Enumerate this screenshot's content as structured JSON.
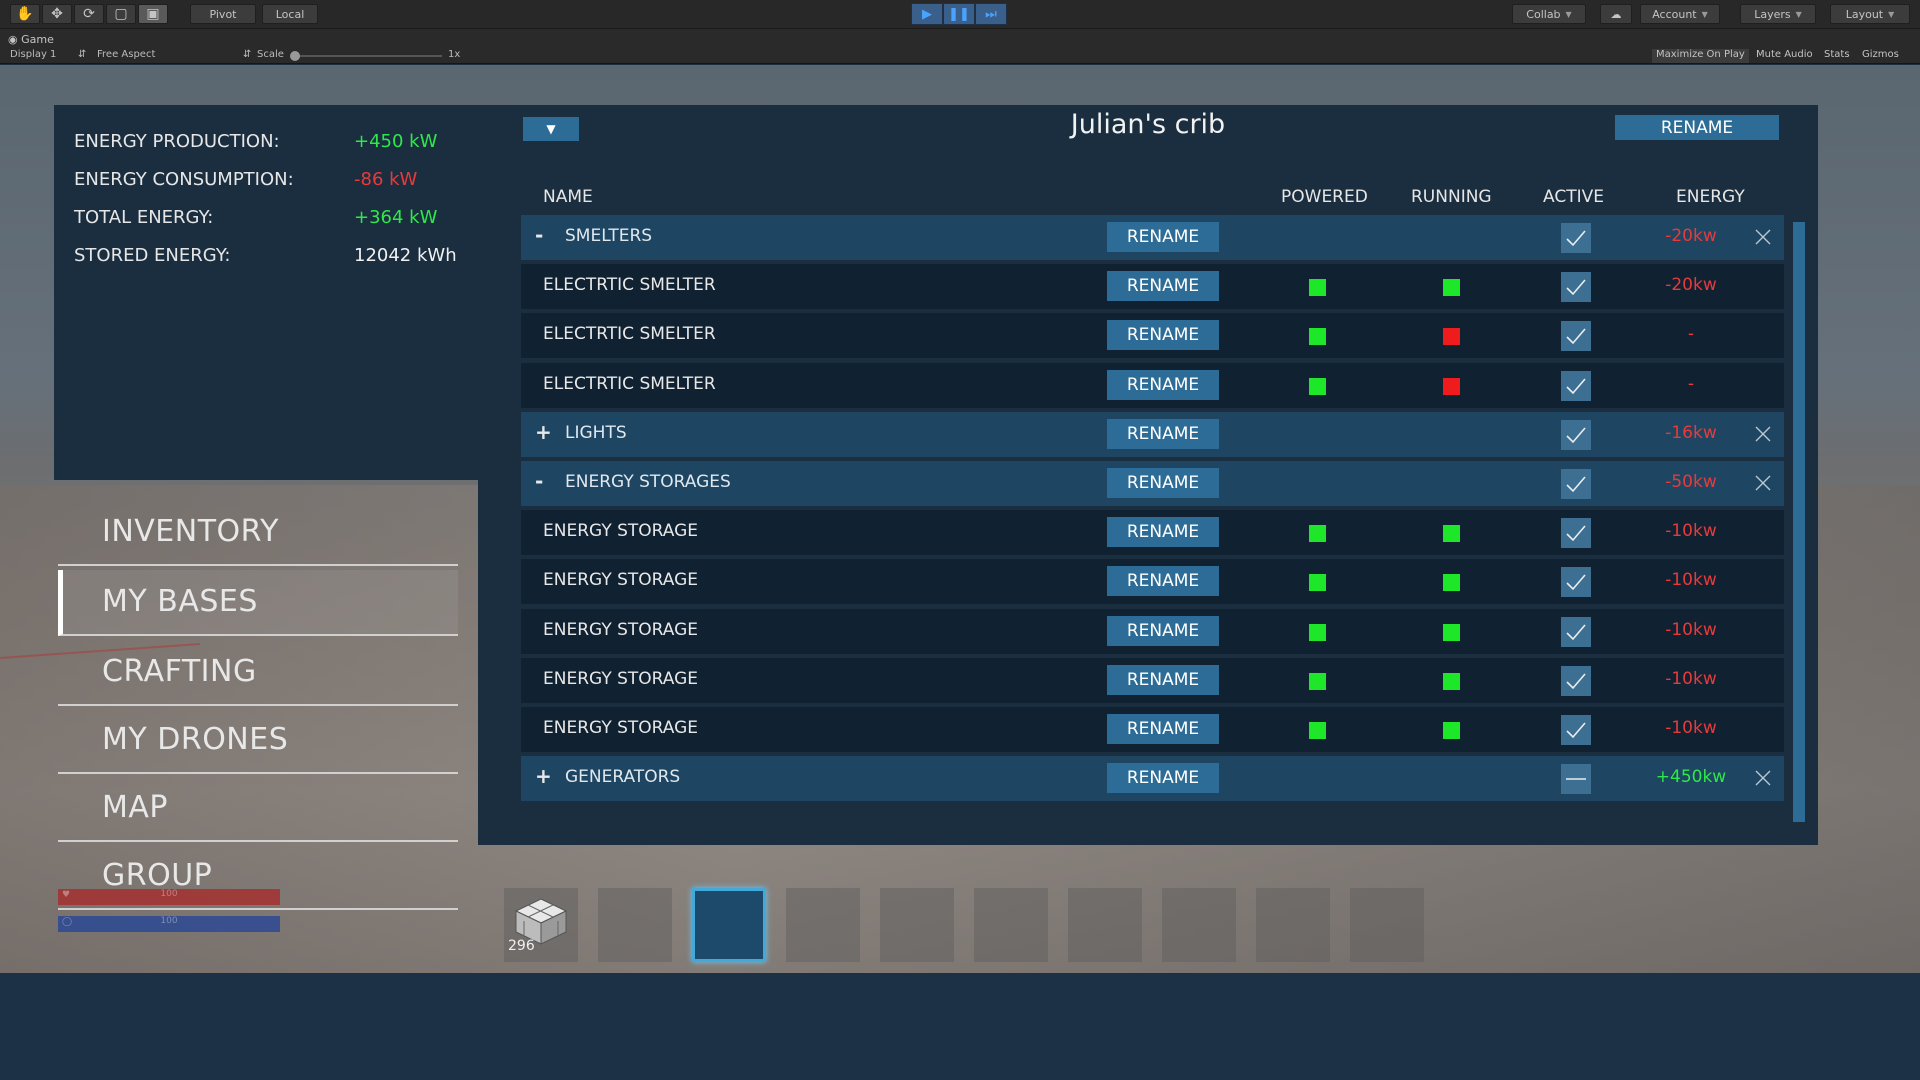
{
  "toolbar": {
    "tools": [
      "hand-tool",
      "move-tool",
      "rotate-tool",
      "scale-tool",
      "rect-tool"
    ],
    "pivot": "Pivot",
    "local": "Local",
    "collab": "Collab",
    "account": "Account",
    "layers": "Layers",
    "layout": "Layout"
  },
  "gamebar": {
    "tab": "Game",
    "display": "Display 1",
    "aspect": "Free Aspect",
    "scale_label": "Scale",
    "scale_value": "1x",
    "maximize": "Maximize On Play",
    "mute": "Mute Audio",
    "stats": "Stats",
    "gizmos": "Gizmos"
  },
  "colors": {
    "positive": "#2ee84a",
    "negative": "#e83a3a",
    "accent": "#2c6c96",
    "indicator_green": "#1ee628",
    "indicator_red": "#ee1c1c"
  },
  "energy": [
    {
      "label": "ENERGY PRODUCTION:",
      "value": "+450 kW",
      "tone": "pos"
    },
    {
      "label": "ENERGY CONSUMPTION:",
      "value": "-86 kW",
      "tone": "neg"
    },
    {
      "label": "TOTAL ENERGY:",
      "value": "+364 kW",
      "tone": "pos"
    },
    {
      "label": "STORED ENERGY:",
      "value": "12042 kWh",
      "tone": "neutral"
    }
  ],
  "menu": [
    {
      "label": "INVENTORY",
      "active": false
    },
    {
      "label": "MY BASES",
      "active": true
    },
    {
      "label": "CRAFTING",
      "active": false
    },
    {
      "label": "MY DRONES",
      "active": false
    },
    {
      "label": "MAP",
      "active": false
    },
    {
      "label": "GROUP",
      "active": false
    }
  ],
  "status_bars": {
    "health": "100",
    "shield": "100"
  },
  "base": {
    "title": "Julian's crib",
    "rename_label": "RENAME",
    "columns": {
      "name": "NAME",
      "powered": "POWERED",
      "running": "RUNNING",
      "active": "ACTIVE",
      "energy": "ENERGY"
    },
    "rows": [
      {
        "kind": "group",
        "toggle": "-",
        "name": "SMELTERS",
        "active": "check",
        "energy": "-20kw",
        "tone": "neg"
      },
      {
        "kind": "item",
        "name": "ELECTRTIC SMELTER",
        "powered": true,
        "running": true,
        "active": "check",
        "energy": "-20kw",
        "tone": "neg"
      },
      {
        "kind": "item",
        "name": "ELECTRTIC SMELTER",
        "powered": true,
        "running": false,
        "active": "check",
        "energy": "-",
        "tone": "neg"
      },
      {
        "kind": "item",
        "name": "ELECTRTIC SMELTER",
        "powered": true,
        "running": false,
        "active": "check",
        "energy": "-",
        "tone": "neg"
      },
      {
        "kind": "group",
        "toggle": "+",
        "name": "LIGHTS",
        "active": "check",
        "energy": "-16kw",
        "tone": "neg"
      },
      {
        "kind": "group",
        "toggle": "-",
        "name": "ENERGY STORAGES",
        "active": "check",
        "energy": "-50kw",
        "tone": "neg"
      },
      {
        "kind": "item",
        "name": "ENERGY STORAGE",
        "powered": true,
        "running": true,
        "active": "check",
        "energy": "-10kw",
        "tone": "neg"
      },
      {
        "kind": "item",
        "name": "ENERGY STORAGE",
        "powered": true,
        "running": true,
        "active": "check",
        "energy": "-10kw",
        "tone": "neg"
      },
      {
        "kind": "item",
        "name": "ENERGY STORAGE",
        "powered": true,
        "running": true,
        "active": "check",
        "energy": "-10kw",
        "tone": "neg"
      },
      {
        "kind": "item",
        "name": "ENERGY STORAGE",
        "powered": true,
        "running": true,
        "active": "check",
        "energy": "-10kw",
        "tone": "neg"
      },
      {
        "kind": "item",
        "name": "ENERGY STORAGE",
        "powered": true,
        "running": true,
        "active": "check",
        "energy": "-10kw",
        "tone": "neg"
      },
      {
        "kind": "group",
        "toggle": "+",
        "name": "GENERATORS",
        "active": "mixed",
        "energy": "+450kw",
        "tone": "pos"
      }
    ]
  },
  "hotbar": {
    "selected_index": 2,
    "slots": [
      {
        "item": "cube-block-icon",
        "count": "296"
      },
      {
        "item": "",
        "count": ""
      },
      {
        "item": "",
        "count": ""
      },
      {
        "item": "",
        "count": ""
      },
      {
        "item": "",
        "count": ""
      },
      {
        "item": "",
        "count": ""
      },
      {
        "item": "",
        "count": ""
      },
      {
        "item": "",
        "count": ""
      },
      {
        "item": "",
        "count": ""
      },
      {
        "item": "",
        "count": ""
      }
    ]
  }
}
